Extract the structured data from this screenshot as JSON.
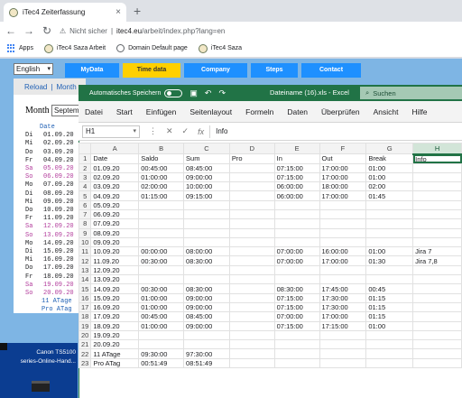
{
  "browser": {
    "tab_title": "iTec4 Zeiterfassung",
    "tab_close": "×",
    "new_tab": "+",
    "nav": {
      "back": "←",
      "forward": "→",
      "reload": "↻"
    },
    "security_label": "Nicht sicher",
    "url_host": "itec4.eu",
    "url_path": "/arbeit/index.php?lang=en",
    "bookmarks": [
      "Apps",
      "iTec4 Saza Arbeit",
      "Domain Default page",
      "iTec4 Saza"
    ]
  },
  "site": {
    "language": "English",
    "nav_tabs": [
      "MyData",
      "Time data",
      "Company",
      "Steps",
      "Contact"
    ],
    "active_tab": "Time data",
    "reload_link": "Reload",
    "separator": "|",
    "month_link": "Month",
    "month_label": "Month",
    "month_value": "September",
    "date_header": "Date",
    "dates": [
      {
        "day": "Di",
        "date": "01.09.20",
        "weekend": false
      },
      {
        "day": "Mi",
        "date": "02.09.20",
        "weekend": false
      },
      {
        "day": "Do",
        "date": "03.09.20",
        "weekend": false
      },
      {
        "day": "Fr",
        "date": "04.09.20",
        "weekend": false
      },
      {
        "day": "Sa",
        "date": "05.09.20",
        "weekend": true
      },
      {
        "day": "So",
        "date": "06.09.20",
        "weekend": true
      },
      {
        "day": "Mo",
        "date": "07.09.20",
        "weekend": false
      },
      {
        "day": "Di",
        "date": "08.09.20",
        "weekend": false
      },
      {
        "day": "Mi",
        "date": "09.09.20",
        "weekend": false
      },
      {
        "day": "Do",
        "date": "10.09.20",
        "weekend": false
      },
      {
        "day": "Fr",
        "date": "11.09.20",
        "weekend": false
      },
      {
        "day": "Sa",
        "date": "12.09.20",
        "weekend": true
      },
      {
        "day": "So",
        "date": "13.09.20",
        "weekend": true
      },
      {
        "day": "Mo",
        "date": "14.09.20",
        "weekend": false
      },
      {
        "day": "Di",
        "date": "15.09.20",
        "weekend": false
      },
      {
        "day": "Mi",
        "date": "16.09.20",
        "weekend": false
      },
      {
        "day": "Do",
        "date": "17.09.20",
        "weekend": false
      },
      {
        "day": "Fr",
        "date": "18.09.20",
        "weekend": false
      },
      {
        "day": "Sa",
        "date": "19.09.20",
        "weekend": true
      },
      {
        "day": "So",
        "date": "20.09.20",
        "weekend": true
      }
    ],
    "summary": [
      "11 ATage",
      "Pro ATag"
    ]
  },
  "desktop": {
    "canon_line1": "Canon TS5100",
    "canon_line2": "series-Online-Hand..."
  },
  "excel": {
    "autosave_label": "Automatisches Speichern",
    "filename": "Dateiname (16).xls  -  Excel",
    "search_placeholder": "Suchen",
    "ribbon_tabs": [
      "Datei",
      "Start",
      "Einfügen",
      "Seitenlayout",
      "Formeln",
      "Daten",
      "Überprüfen",
      "Ansicht",
      "Hilfe"
    ],
    "name_box": "H1",
    "formula_icons": [
      "✕",
      "✓",
      "fx"
    ],
    "formula_value": "Info",
    "columns": [
      "A",
      "B",
      "C",
      "D",
      "E",
      "F",
      "G",
      "H"
    ],
    "rows": [
      [
        "Date",
        "Saldo",
        "Sum",
        "Pro",
        "In",
        "Out",
        "Break",
        "Info"
      ],
      [
        "01.09.20",
        "00:45:00",
        "08:45:00",
        "",
        "07:15:00",
        "17:00:00",
        "01:00",
        ""
      ],
      [
        "02.09.20",
        "01:00:00",
        "09:00:00",
        "",
        "07:15:00",
        "17:00:00",
        "01:00",
        ""
      ],
      [
        "03.09.20",
        "02:00:00",
        "10:00:00",
        "",
        "06:00:00",
        "18:00:00",
        "02:00",
        ""
      ],
      [
        "04.09.20",
        "01:15:00",
        "09:15:00",
        "",
        "06:00:00",
        "17:00:00",
        "01:45",
        ""
      ],
      [
        "05.09.20",
        "",
        "",
        "",
        "",
        "",
        "",
        ""
      ],
      [
        "06.09.20",
        "",
        "",
        "",
        "",
        "",
        "",
        ""
      ],
      [
        "07.09.20",
        "",
        "",
        "",
        "",
        "",
        "",
        ""
      ],
      [
        "08.09.20",
        "",
        "",
        "",
        "",
        "",
        "",
        ""
      ],
      [
        "09.09.20",
        "",
        "",
        "",
        "",
        "",
        "",
        ""
      ],
      [
        "10.09.20",
        "00:00:00",
        "08:00:00",
        "",
        "07:00:00",
        "16:00:00",
        "01:00",
        "Jira 7"
      ],
      [
        "11.09.20",
        "00:30:00",
        "08:30:00",
        "",
        "07:00:00",
        "17:00:00",
        "01:30",
        "Jira 7,8"
      ],
      [
        "12.09.20",
        "",
        "",
        "",
        "",
        "",
        "",
        ""
      ],
      [
        "13.09.20",
        "",
        "",
        "",
        "",
        "",
        "",
        ""
      ],
      [
        "14.09.20",
        "00:30:00",
        "08:30:00",
        "",
        "08:30:00",
        "17:45:00",
        "00:45",
        ""
      ],
      [
        "15.09.20",
        "01:00:00",
        "09:00:00",
        "",
        "07:15:00",
        "17:30:00",
        "01:15",
        ""
      ],
      [
        "16.09.20",
        "01:00:00",
        "09:00:00",
        "",
        "07:15:00",
        "17:30:00",
        "01:15",
        ""
      ],
      [
        "17.09.20",
        "00:45:00",
        "08:45:00",
        "",
        "07:00:00",
        "17:00:00",
        "01:15",
        ""
      ],
      [
        "18.09.20",
        "01:00:00",
        "09:00:00",
        "",
        "07:15:00",
        "17:15:00",
        "01:00",
        ""
      ],
      [
        "19.09.20",
        "",
        "",
        "",
        "",
        "",
        "",
        ""
      ],
      [
        "20.09.20",
        "",
        "",
        "",
        "",
        "",
        "",
        ""
      ],
      [
        "11 ATage",
        "09:30:00",
        "97:30:00",
        "",
        "",
        "",
        "",
        ""
      ],
      [
        "Pro ATag",
        "00:51:49",
        "08:51:49",
        "",
        "",
        "",
        "",
        ""
      ]
    ]
  }
}
